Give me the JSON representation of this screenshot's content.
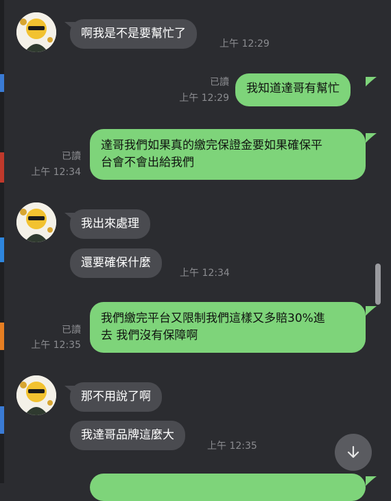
{
  "colors": {
    "background": "#2b2c30",
    "incoming_bubble": "#4a4b50",
    "outgoing_bubble": "#7ed47a",
    "meta_text": "#8b8c90"
  },
  "messages": [
    {
      "dir": "in",
      "text": "啊我是不是要幫忙了",
      "time": "上午 12:29"
    },
    {
      "dir": "out",
      "text": "我知道達哥有幫忙",
      "read": "已讀",
      "time": "上午 12:29"
    },
    {
      "dir": "out",
      "text": "達哥我們如果真的繳完保證金要如果確保平\n台會不會出給我們",
      "read": "已讀",
      "time": "上午 12:34"
    },
    {
      "dir": "in",
      "text": "我出來處理"
    },
    {
      "dir": "in",
      "text": "還要確保什麼",
      "time": "上午 12:34"
    },
    {
      "dir": "out",
      "text": "我們繳完平台又限制我們這樣又多賠30%進\n去 我們沒有保障啊",
      "read": "已讀",
      "time": "上午 12:35"
    },
    {
      "dir": "in",
      "text": "那不用說了啊"
    },
    {
      "dir": "in",
      "text": "我達哥品牌這麼大",
      "time": "上午 12:35"
    }
  ],
  "scroll_button": {
    "icon": "arrow-down-icon"
  }
}
